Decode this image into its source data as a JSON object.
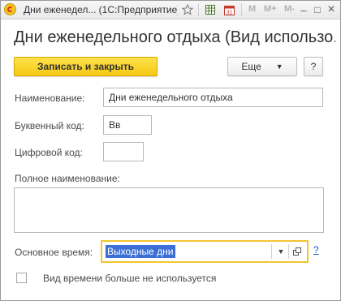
{
  "titlebar": {
    "title": "Дни еженедел... (1С:Предприятие)",
    "icons": [
      "star-icon",
      "table-icon",
      "calendar-icon"
    ],
    "calendar_day": "31",
    "memory_buttons": [
      "M",
      "M+",
      "M-"
    ],
    "window_buttons": {
      "minimize": "–",
      "maximize": "□",
      "close": "×"
    }
  },
  "form": {
    "title": "Дни еженедельного отдыха (Вид использо...",
    "save_close_label": "Записать и закрыть",
    "more_label": "Еще",
    "help_label": "?"
  },
  "fields": {
    "name_label": "Наименование:",
    "name_value": "Дни еженедельного отдыха",
    "letter_code_label": "Буквенный код:",
    "letter_code_value": "Вв",
    "digit_code_label": "Цифровой код:",
    "digit_code_value": "",
    "full_name_label": "Полное наименование:",
    "full_name_value": "",
    "main_time_label": "Основное время:",
    "main_time_value": "Выходные дни",
    "main_time_help": "?",
    "not_used_label": "Вид времени больше не используется",
    "not_used_checked": false
  },
  "colors": {
    "accent_button": "#f5c914",
    "focus_border": "#f2c530",
    "selection": "#3b6fd6",
    "link": "#1e5fbf"
  }
}
